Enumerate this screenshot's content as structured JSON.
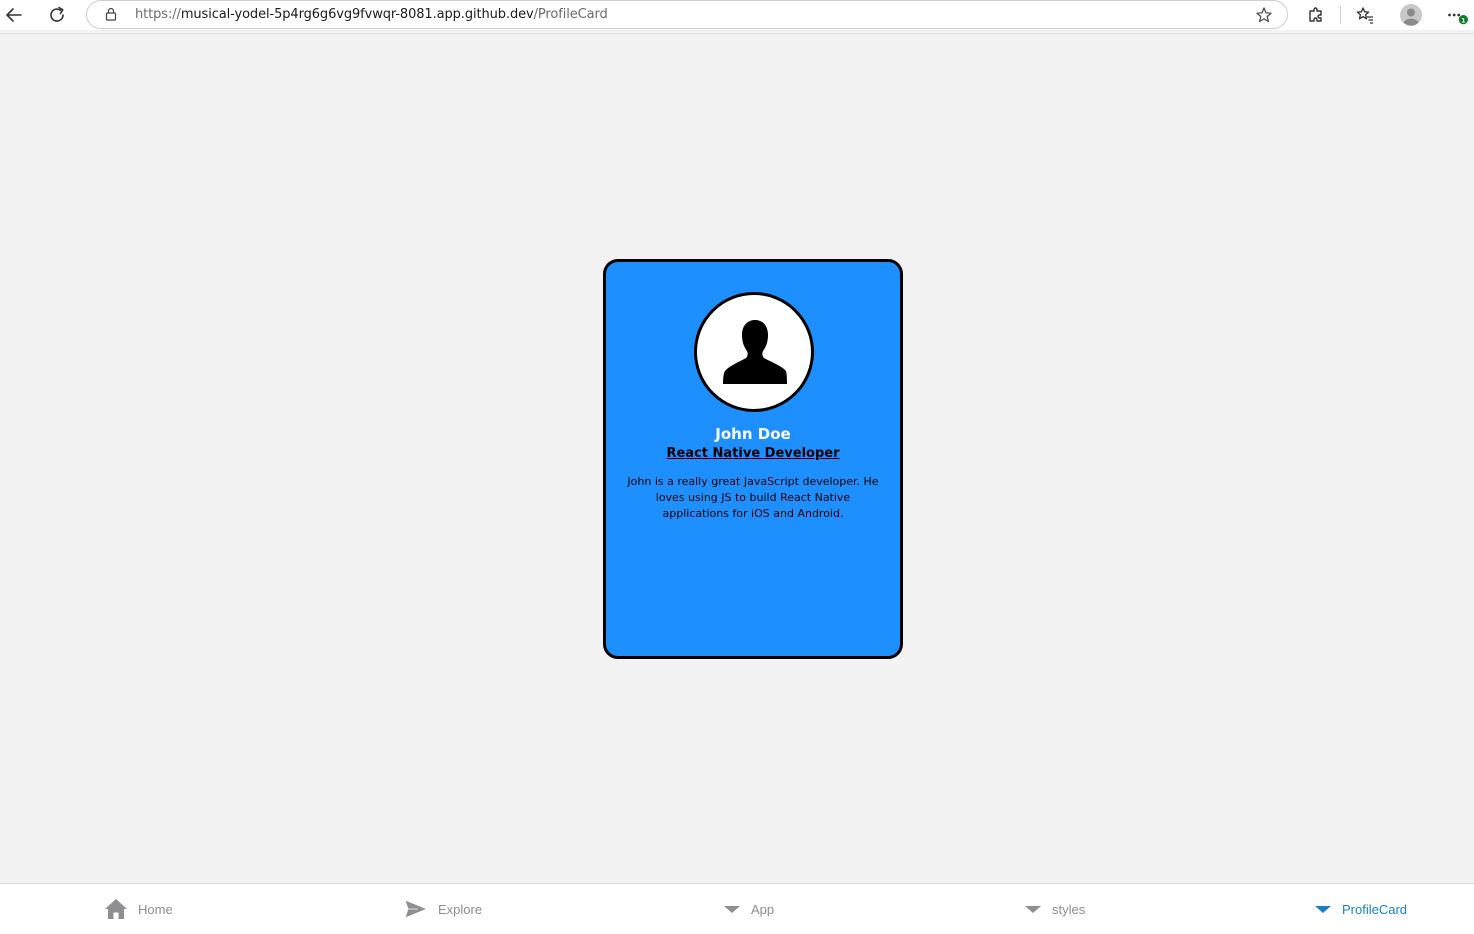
{
  "browser": {
    "url_scheme": "https://",
    "url_host": "musical-yodel-5p4rg6g6vg9fvwqr-8081.app.github.dev",
    "url_path": "/ProfileCard",
    "notification_count": "1"
  },
  "profile": {
    "name": "John Doe",
    "occupation": "React Native Developer",
    "description": "John is a really great JavaScript developer. He loves using JS to build React Native applications for iOS and Android."
  },
  "tabs": [
    {
      "label": "Home",
      "icon": "home-icon"
    },
    {
      "label": "Explore",
      "icon": "send-icon"
    },
    {
      "label": "App",
      "icon": "caret-down-icon"
    },
    {
      "label": "styles",
      "icon": "caret-down-icon"
    },
    {
      "label": "ProfileCard",
      "icon": "caret-down-icon",
      "active": true
    }
  ],
  "colors": {
    "card_background": "#1e8fff",
    "active_tab": "#1a7fc4",
    "inactive_tab": "#8e8e93",
    "page_background": "#f2f2f2"
  }
}
